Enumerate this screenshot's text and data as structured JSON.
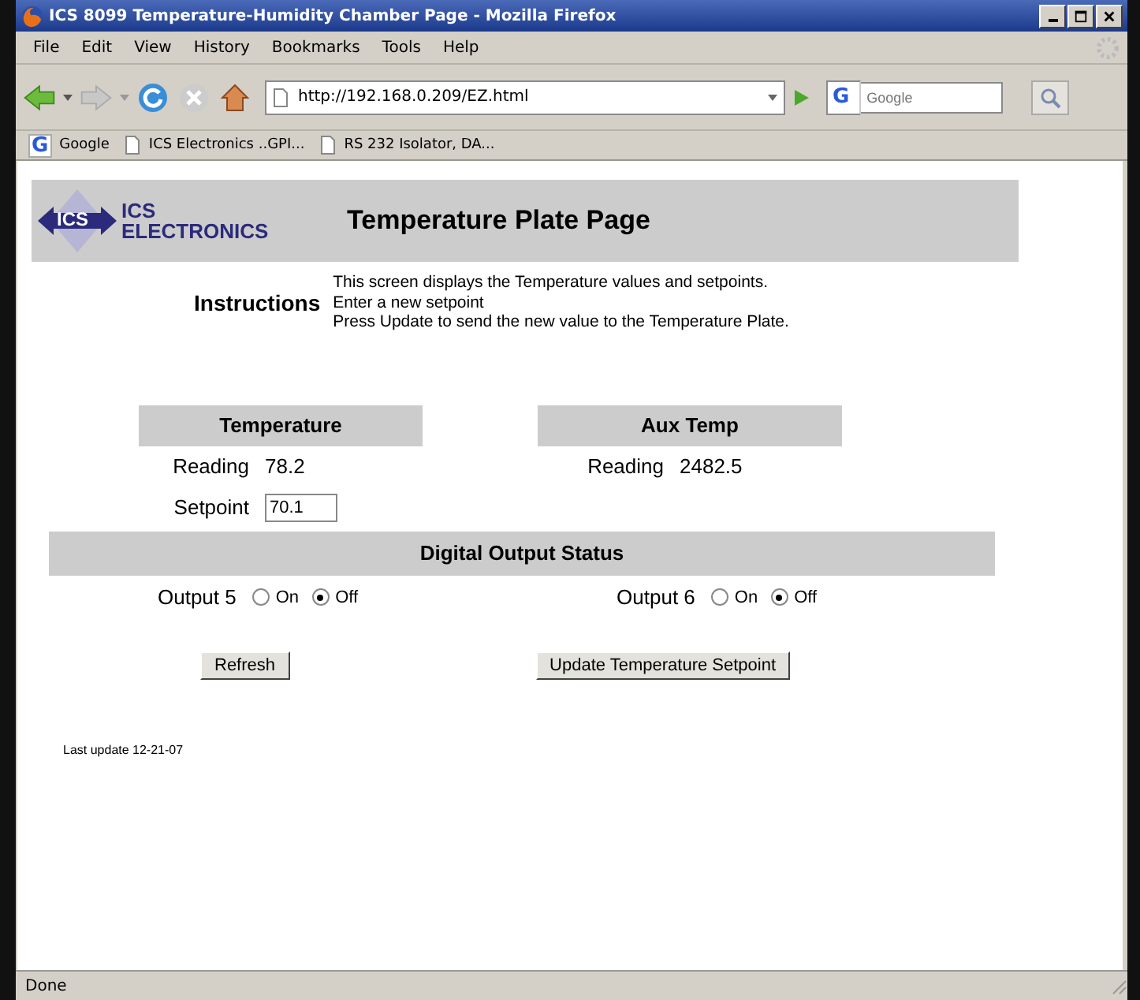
{
  "window": {
    "title": "ICS 8099 Temperature-Humidity Chamber Page - Mozilla Firefox"
  },
  "menu": [
    "File",
    "Edit",
    "View",
    "History",
    "Bookmarks",
    "Tools",
    "Help"
  ],
  "address": {
    "value": "http://192.168.0.209/EZ.html"
  },
  "search": {
    "engine_icon": "G",
    "placeholder": "Google"
  },
  "bookmarks": [
    {
      "label": "Google",
      "kind": "google",
      "icon": "G"
    },
    {
      "label": "ICS Electronics ..GPI...",
      "kind": "page"
    },
    {
      "label": "RS 232 Isolator, DA...",
      "kind": "page"
    }
  ],
  "page": {
    "logo": {
      "badge": "ICS",
      "line1": "ICS",
      "line2": "ELECTRONICS"
    },
    "heading": "Temperature Plate Page",
    "instructions": {
      "label": "Instructions",
      "lines": [
        "This screen displays the Temperature values and setpoints.",
        "Enter a new setpoint",
        "Press Update to send the new value to the Temperature Plate."
      ]
    },
    "panels": [
      {
        "title": "Temperature",
        "rows": [
          {
            "label": "Reading",
            "value": "78.2",
            "kind": "text"
          },
          {
            "label": "Setpoint",
            "value": "70.1",
            "kind": "input"
          }
        ]
      },
      {
        "title": "Aux Temp",
        "rows": [
          {
            "label": "Reading",
            "value": "2482.5",
            "kind": "text"
          }
        ]
      }
    ],
    "outputs_title": "Digital Output Status",
    "outputs": [
      {
        "label": "Output 5",
        "options": [
          {
            "label": "On",
            "selected": false
          },
          {
            "label": "Off",
            "selected": true
          }
        ]
      },
      {
        "label": "Output 6",
        "options": [
          {
            "label": "On",
            "selected": false
          },
          {
            "label": "Off",
            "selected": true
          }
        ]
      }
    ],
    "buttons": [
      "Refresh",
      "Update Temperature Setpoint"
    ],
    "last_update": "Last update 12-21-07"
  },
  "status_bar": "Done"
}
